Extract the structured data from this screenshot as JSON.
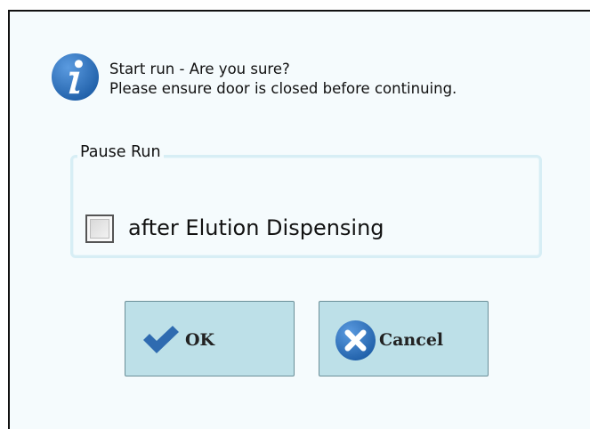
{
  "message": {
    "line1": "Start run - Are you sure?",
    "line2": "Please ensure door is closed before continuing."
  },
  "pause_group": {
    "title": "Pause Run",
    "checkbox_label": "after Elution Dispensing",
    "checked": false
  },
  "buttons": {
    "ok_label": "OK",
    "cancel_label": "Cancel"
  },
  "icons": {
    "info": "info-icon",
    "ok": "checkmark-icon",
    "cancel": "close-circle-icon"
  },
  "colors": {
    "accent": "#2f6bb0",
    "button_bg": "#bde0e8",
    "group_border": "#d7eef5",
    "dialog_bg": "#f5fbfd"
  }
}
